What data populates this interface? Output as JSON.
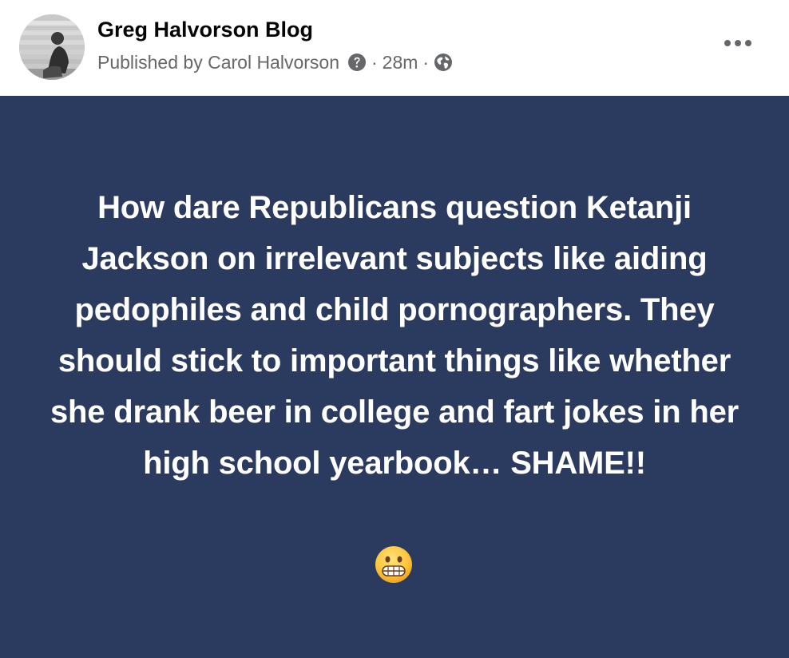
{
  "post": {
    "page_name": "Greg Halvorson Blog",
    "published_by": "Published by Carol Halvorson",
    "separator": "·",
    "time_ago": "28m",
    "help_icon": "question-circle-icon",
    "audience_icon": "globe-icon",
    "more_icon": "more-horizontal-icon",
    "avatar": "profile-photo-avatar",
    "background_color": "#2b3a5f",
    "text_color": "#ffffff",
    "body_text": "How dare Republicans question Ketanji Jackson on irrelevant subjects like aiding pedophiles and child pornographers. They should stick to important things like whether she drank beer in college and fart jokes in her high school yearbook… SHAME!!",
    "emoji_icon": "grimacing-face-emoji"
  }
}
